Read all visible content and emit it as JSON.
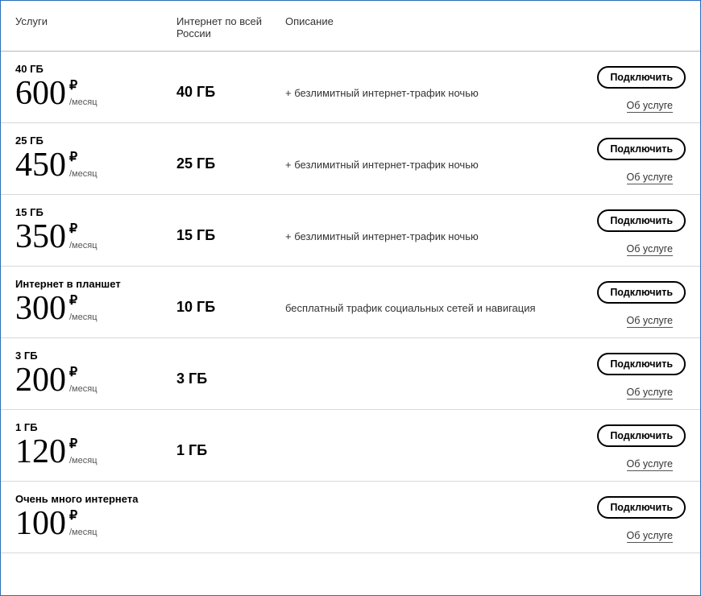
{
  "headers": {
    "service": "Услуги",
    "data": "Интернет по всей России",
    "desc": "Описание"
  },
  "common": {
    "currency": "₽",
    "period": "/месяц",
    "connect": "Подключить",
    "about": "Об услуге"
  },
  "plans": [
    {
      "name": "40 ГБ",
      "price": "600",
      "data": "40 ГБ",
      "desc": "+ безлимитный интернет-трафик ночью"
    },
    {
      "name": "25 ГБ",
      "price": "450",
      "data": "25 ГБ",
      "desc": "+ безлимитный интернет-трафик ночью"
    },
    {
      "name": "15 ГБ",
      "price": "350",
      "data": "15 ГБ",
      "desc": "+ безлимитный интернет-трафик ночью"
    },
    {
      "name": "Интернет в планшет",
      "price": "300",
      "data": "10 ГБ",
      "desc": "бесплатный трафик социальных сетей и навигация"
    },
    {
      "name": "3 ГБ",
      "price": "200",
      "data": "3 ГБ",
      "desc": ""
    },
    {
      "name": "1 ГБ",
      "price": "120",
      "data": "1 ГБ",
      "desc": ""
    },
    {
      "name": "Очень много интернета",
      "price": "100",
      "data": "",
      "desc": ""
    }
  ]
}
